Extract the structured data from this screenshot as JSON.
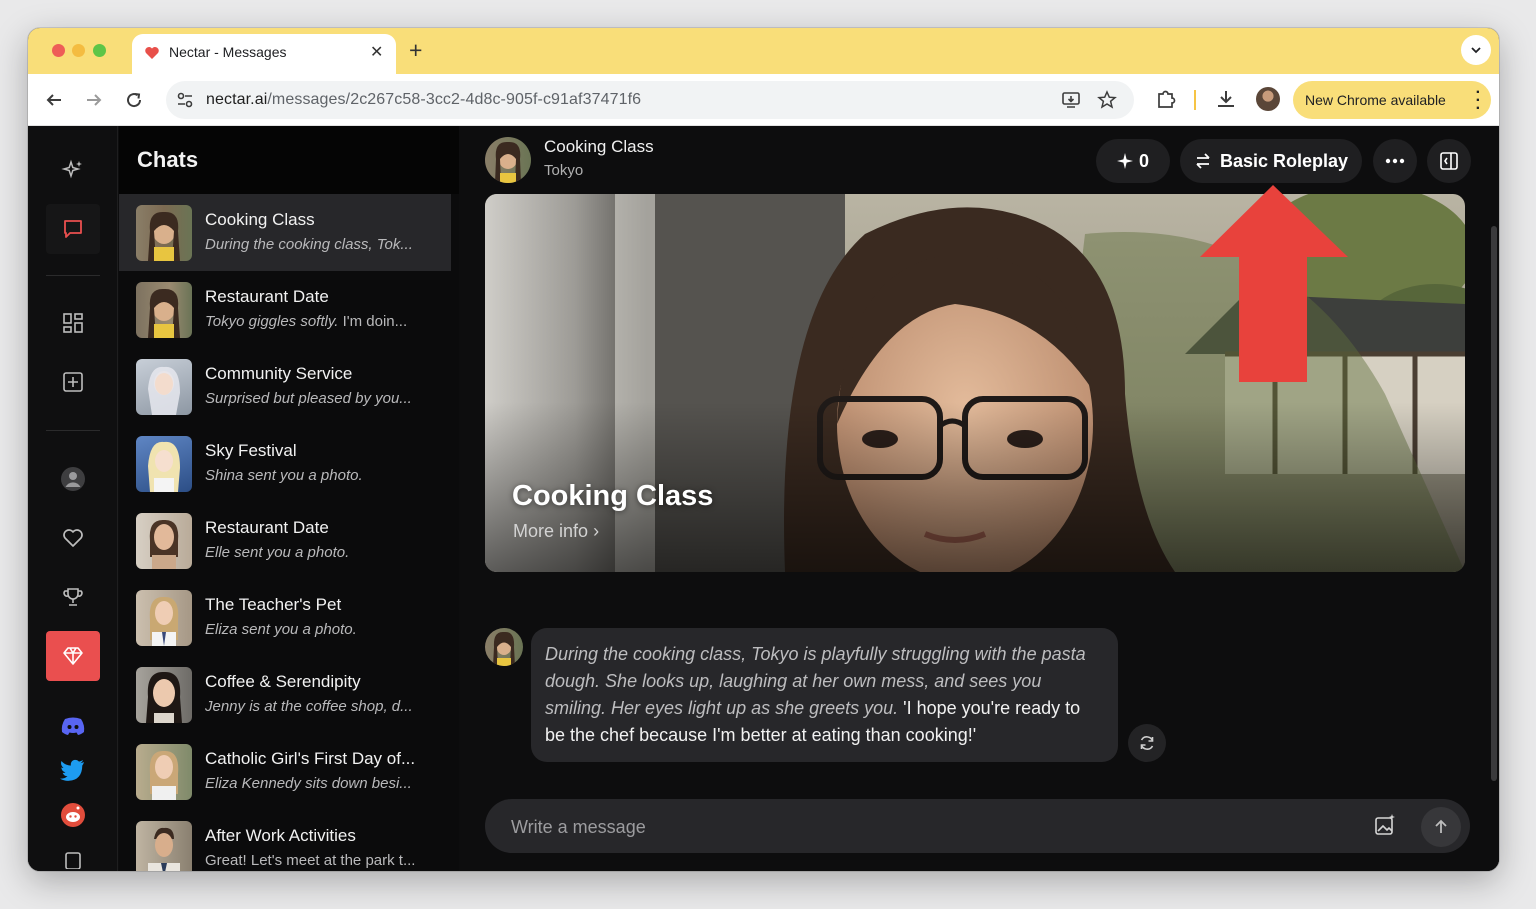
{
  "browser": {
    "tab_title": "Nectar - Messages",
    "url_domain": "nectar.ai",
    "url_path": "/messages/2c267c58-3cc2-4d8c-905f-c91af37471f6",
    "update_label": "New Chrome available"
  },
  "sidebar": {
    "title": "Chats",
    "chats": [
      {
        "name": "Cooking Class",
        "preview": "During the cooking class, Tok...",
        "italic": true,
        "selected": true
      },
      {
        "name": "Restaurant Date",
        "preview_italic": "Tokyo giggles softly.",
        "preview_rest": " I'm doin..."
      },
      {
        "name": "Community Service",
        "preview": "Surprised but pleased by you...",
        "italic": true
      },
      {
        "name": "Sky Festival",
        "preview": "Shina sent you a photo.",
        "italic": true
      },
      {
        "name": "Restaurant Date",
        "preview": "Elle sent you a photo.",
        "italic": true
      },
      {
        "name": "The Teacher's Pet",
        "preview": "Eliza sent you a photo.",
        "italic": true
      },
      {
        "name": "Coffee & Serendipity",
        "preview": "Jenny is at the coffee shop, d...",
        "italic": true
      },
      {
        "name": "Catholic Girl's First Day of...",
        "preview": "Eliza Kennedy sits down besi...",
        "italic": true
      },
      {
        "name": "After Work Activities",
        "preview": "Great! Let's meet at the park t...",
        "italic": false
      }
    ]
  },
  "chat": {
    "name": "Cooking Class",
    "character": "Tokyo",
    "spark_count": "0",
    "mode_label": "Basic Roleplay",
    "hero_title": "Cooking Class",
    "hero_more": "More info",
    "message_narration": "During the cooking class, Tokyo is playfully struggling with the pasta dough. She looks up, laughing at her own mess, and sees you smiling. Her eyes light up as she greets you.",
    "message_speech": " 'I hope you're ready to be the chef because I'm better at eating than cooking!'",
    "composer_placeholder": "Write a message"
  },
  "colors": {
    "chrome_yellow": "#f9de79",
    "premium_red": "#ea4f4f",
    "annotation_arrow": "#e8423c"
  }
}
